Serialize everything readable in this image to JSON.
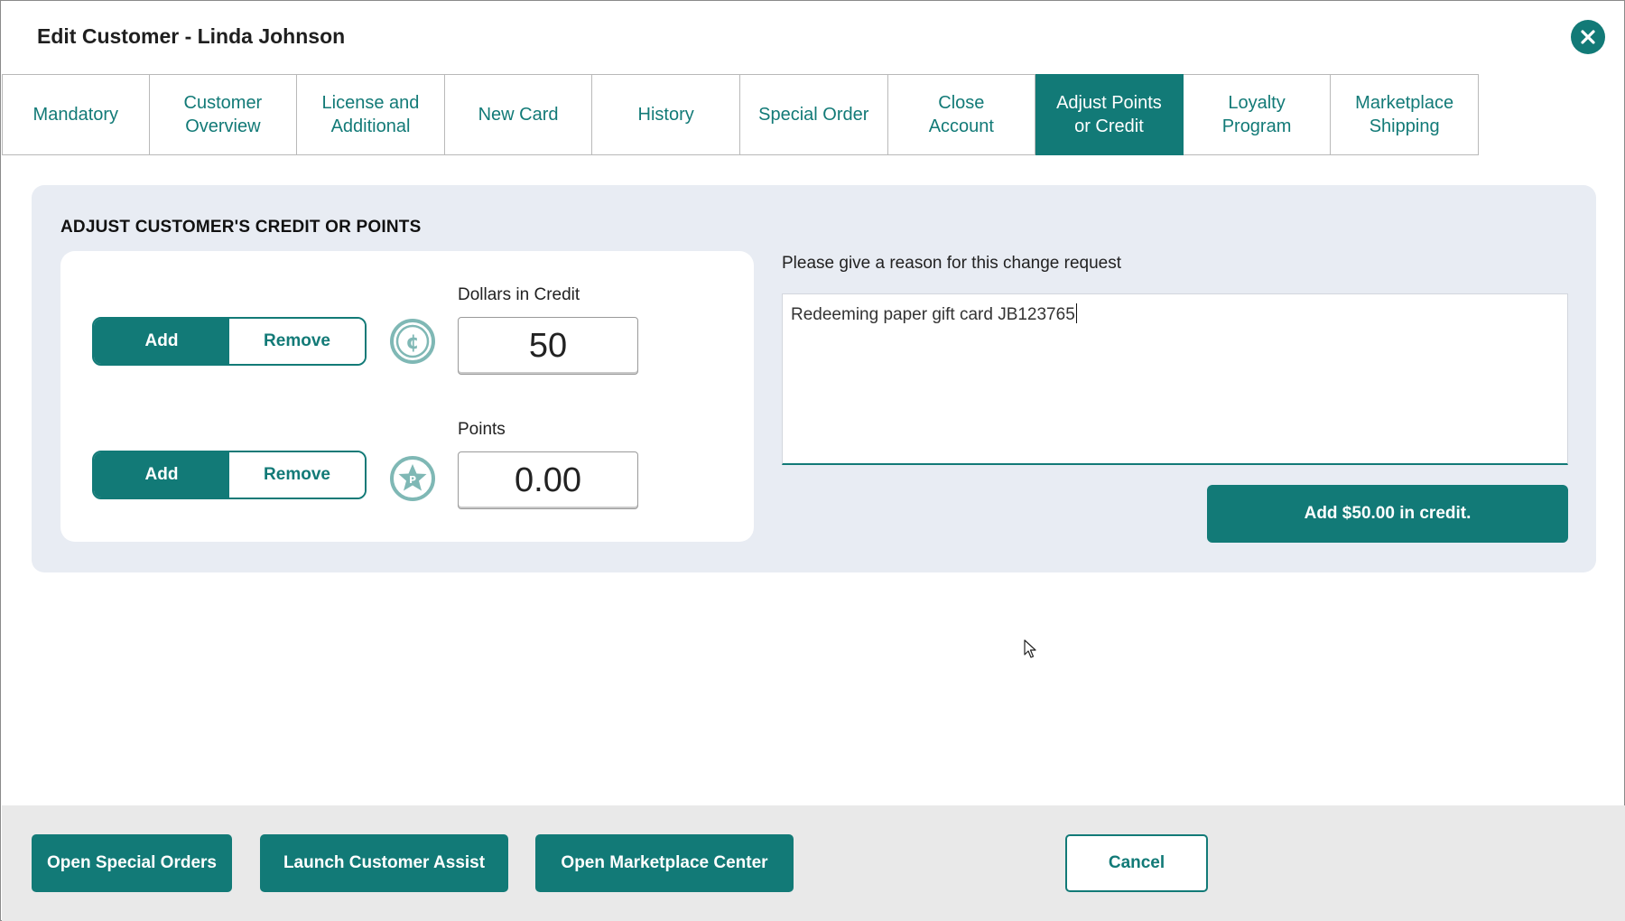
{
  "window": {
    "title": "Edit Customer - Linda Johnson"
  },
  "tabs": [
    {
      "label": "Mandatory",
      "active": false
    },
    {
      "label": "Customer\nOverview",
      "active": false
    },
    {
      "label": "License and\nAdditional",
      "active": false
    },
    {
      "label": "New Card",
      "active": false
    },
    {
      "label": "History",
      "active": false
    },
    {
      "label": "Special Order",
      "active": false
    },
    {
      "label": "Close\nAccount",
      "active": false
    },
    {
      "label": "Adjust Points\nor Credit",
      "active": true
    },
    {
      "label": "Loyalty\nProgram",
      "active": false
    },
    {
      "label": "Marketplace\nShipping",
      "active": false
    }
  ],
  "panel": {
    "title": "ADJUST CUSTOMER'S CREDIT OR POINTS",
    "credit": {
      "add_label": "Add",
      "remove_label": "Remove",
      "selected": "Add",
      "icon": "credit-coin-icon",
      "field_label": "Dollars in Credit",
      "value": "50"
    },
    "points": {
      "add_label": "Add",
      "remove_label": "Remove",
      "selected": "Add",
      "icon": "points-star-icon",
      "field_label": "Points",
      "value": "0.00"
    },
    "reason": {
      "label": "Please give a reason for this change request",
      "value": "Redeeming paper gift card JB123765"
    },
    "submit_label": "Add $50.00 in credit."
  },
  "footer": {
    "open_special_orders": "Open Special Orders",
    "launch_customer_assist": "Launch Customer Assist",
    "open_marketplace_center": "Open Marketplace Center",
    "cancel": "Cancel"
  },
  "colors": {
    "accent": "#127a77",
    "panel_bg": "#e8ecf3",
    "footer_bg": "#e9e9e9",
    "icon_tint": "#7fb8b5"
  }
}
